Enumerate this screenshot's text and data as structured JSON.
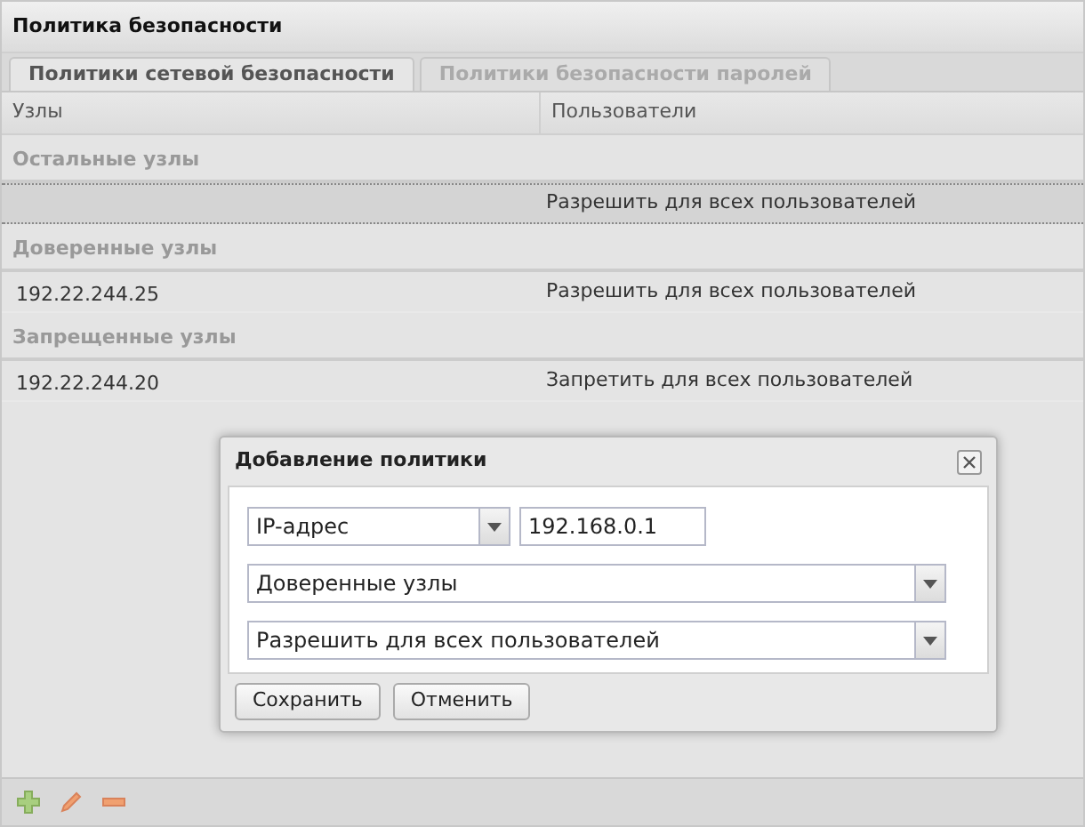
{
  "panel": {
    "title": "Политика безопасности"
  },
  "tabs": [
    {
      "label": "Политики сетевой безопасности",
      "selected": true
    },
    {
      "label": "Политики безопасности паролей",
      "selected": false
    }
  ],
  "table": {
    "columns": [
      "Узлы",
      "Пользователи"
    ],
    "groups": [
      {
        "name": "Остальные узлы",
        "rows": [
          {
            "host": "",
            "users": "Разрешить для всех пользователей",
            "selected": true
          }
        ]
      },
      {
        "name": "Доверенные узлы",
        "rows": [
          {
            "host": "192.22.244.25",
            "users": "Разрешить для всех пользователей",
            "selected": false
          }
        ]
      },
      {
        "name": "Запрещенные узлы",
        "rows": [
          {
            "host": "192.22.244.20",
            "users": "Запретить для всех пользователей",
            "selected": false
          }
        ]
      }
    ]
  },
  "dialog": {
    "title": "Добавление политики",
    "address_type": "IP-адрес",
    "address": "192.168.0.1",
    "group": "Доверенные узлы",
    "users": "Разрешить для всех пользователей",
    "buttons": [
      "Сохранить",
      "Отменить"
    ]
  }
}
